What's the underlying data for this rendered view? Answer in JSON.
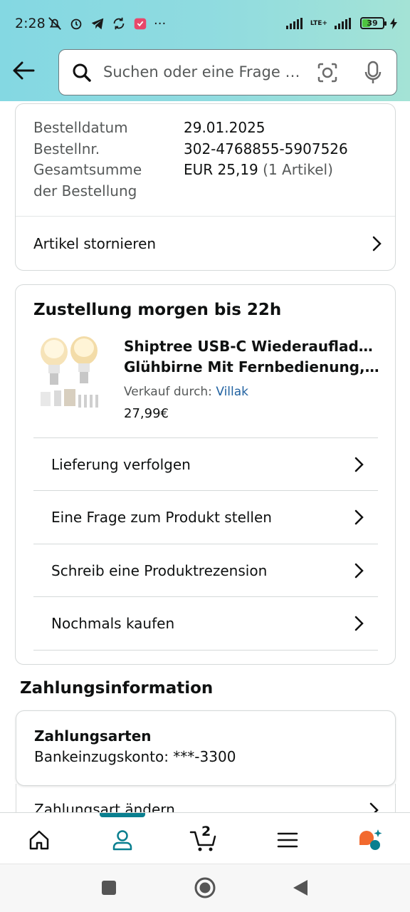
{
  "status_bar": {
    "time": "2:28",
    "more": "···",
    "battery": "39",
    "network": "LTE+"
  },
  "search": {
    "placeholder": "Suchen oder eine Frage stellen"
  },
  "order": {
    "date_label": "Bestelldatum",
    "date_value": "29.01.2025",
    "number_label": "Bestellnr.",
    "number_value": "302-4768855-5907526",
    "total_label_line1": "Gesamtsumme",
    "total_label_line2": "der Bestellung",
    "total_value": "EUR 25,19",
    "total_items": "(1 Artikel)",
    "cancel_label": "Artikel stornieren"
  },
  "delivery": {
    "heading": "Zustellung morgen bis 22h",
    "product_title_line1": "Shiptree USB-C Wiederaufladbare",
    "product_title_line2": "Glühbirne Mit Fernbedienung, E...",
    "sold_by_label": "Verkauf durch:",
    "seller": "Villak",
    "price": "27,99€",
    "actions": [
      {
        "label": "Lieferung verfolgen"
      },
      {
        "label": "Eine Frage zum Produkt stellen"
      },
      {
        "label": "Schreib eine Produktrezension"
      },
      {
        "label": "Nochmals kaufen"
      }
    ]
  },
  "payment": {
    "section_title": "Zahlungsinformation",
    "methods_title": "Zahlungsarten",
    "account": "Bankeinzugskonto: ***-3300",
    "change_label": "Zahlungsart ändern"
  },
  "bottom_nav": {
    "cart_count": "2",
    "items": [
      "home-icon",
      "account-icon",
      "cart-icon",
      "menu-icon",
      "rufus-icon"
    ],
    "accent": "#0a7f8f"
  }
}
